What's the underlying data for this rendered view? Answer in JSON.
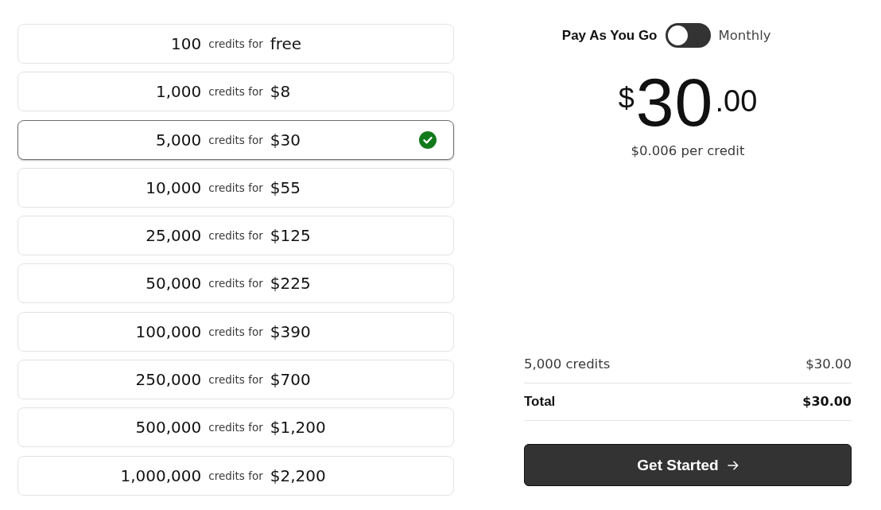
{
  "packages": [
    {
      "credits": "100",
      "label": "credits for",
      "price": "free",
      "selected": false
    },
    {
      "credits": "1,000",
      "label": "credits for",
      "price": "$8",
      "selected": false
    },
    {
      "credits": "5,000",
      "label": "credits for",
      "price": "$30",
      "selected": true
    },
    {
      "credits": "10,000",
      "label": "credits for",
      "price": "$55",
      "selected": false
    },
    {
      "credits": "25,000",
      "label": "credits for",
      "price": "$125",
      "selected": false
    },
    {
      "credits": "50,000",
      "label": "credits for",
      "price": "$225",
      "selected": false
    },
    {
      "credits": "100,000",
      "label": "credits for",
      "price": "$390",
      "selected": false
    },
    {
      "credits": "250,000",
      "label": "credits for",
      "price": "$700",
      "selected": false
    },
    {
      "credits": "500,000",
      "label": "credits for",
      "price": "$1,200",
      "selected": false
    },
    {
      "credits": "1,000,000",
      "label": "credits for",
      "price": "$2,200",
      "selected": false
    }
  ],
  "billing_toggle": {
    "left_label": "Pay As You Go",
    "right_label": "Monthly",
    "on": false
  },
  "price": {
    "currency": "$",
    "whole": "30",
    "fraction": ".00",
    "per_credit": "$0.006 per credit"
  },
  "summary": [
    {
      "kind": "item",
      "label": "5,000 credits",
      "amount": "$30.00"
    },
    {
      "kind": "total",
      "label": "Total",
      "amount": "$30.00"
    }
  ],
  "button": {
    "label": "Get Started"
  }
}
